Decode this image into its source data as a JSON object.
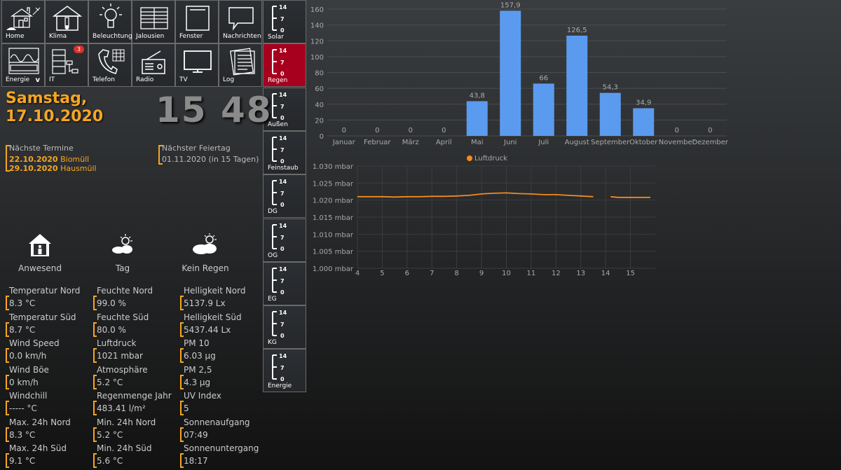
{
  "nav": [
    {
      "label": "Home",
      "icon": "house-icon"
    },
    {
      "label": "Klima",
      "icon": "thermometer-house-icon"
    },
    {
      "label": "Beleuchtung",
      "icon": "lightbulb-icon"
    },
    {
      "label": "Jalousien",
      "icon": "blinds-icon"
    },
    {
      "label": "Fenster",
      "icon": "window-icon"
    },
    {
      "label": "Nachrichten",
      "icon": "speech-bubble-icon"
    },
    {
      "label": "Energie",
      "icon": "energy-meter-icon"
    },
    {
      "label": "IT",
      "icon": "server-network-icon",
      "badge": "3"
    },
    {
      "label": "Telefon",
      "icon": "telephone-icon"
    },
    {
      "label": "Radio",
      "icon": "radio-icon"
    },
    {
      "label": "TV",
      "icon": "tv-icon"
    },
    {
      "label": "Log",
      "icon": "log-document-icon"
    }
  ],
  "side_tiles": [
    {
      "label": "Solar",
      "scale": [
        "14",
        "7",
        "0"
      ]
    },
    {
      "label": "Regen",
      "scale": [
        "14",
        "7",
        "0"
      ],
      "active": true
    },
    {
      "label": "Außen",
      "scale": [
        "14",
        "7",
        "0"
      ]
    },
    {
      "label": "Feinstaub",
      "scale": [
        "14",
        "7",
        "0"
      ]
    },
    {
      "label": "DG",
      "scale": [
        "14",
        "7",
        "0"
      ]
    },
    {
      "label": "OG",
      "scale": [
        "14",
        "7",
        "0"
      ]
    },
    {
      "label": "EG",
      "scale": [
        "14",
        "7",
        "0"
      ]
    },
    {
      "label": "KG",
      "scale": [
        "14",
        "7",
        "0"
      ]
    },
    {
      "label": "Energie",
      "scale": [
        "14",
        "7",
        "0"
      ]
    }
  ],
  "date": {
    "line1": "Samstag,",
    "line2": "17.10.2020"
  },
  "clock": {
    "hours": "15",
    "minutes": "48"
  },
  "termine": {
    "title": "Nächste Termine",
    "items": [
      {
        "date": "22.10.2020",
        "text": "Biomüll"
      },
      {
        "date": "29.10.2020",
        "text": "Hausmüll"
      }
    ]
  },
  "feiertag": {
    "title": "Nächster Feiertag",
    "value": "01.11.2020 (in 15 Tagen)"
  },
  "status": [
    {
      "label": "Anwesend",
      "icon": "house-person-icon"
    },
    {
      "label": "Tag",
      "icon": "sun-cloud-icon"
    },
    {
      "label": "Kein Regen",
      "icon": "cloud-sun-icon"
    }
  ],
  "sensors": [
    [
      {
        "name": "Temperatur Nord",
        "value": "8.3 °C"
      },
      {
        "name": "Temperatur Süd",
        "value": "8.7 °C"
      },
      {
        "name": "Wind Speed",
        "value": "0.0 km/h"
      },
      {
        "name": "Wind Böe",
        "value": "0 km/h"
      },
      {
        "name": "Windchill",
        "value": "----- °C"
      },
      {
        "name": "Max. 24h Nord",
        "value": "8.3 °C"
      },
      {
        "name": "Max. 24h Süd",
        "value": "9.1 °C"
      }
    ],
    [
      {
        "name": "Feuchte Nord",
        "value": "99.0 %"
      },
      {
        "name": "Feuchte Süd",
        "value": "80.0 %"
      },
      {
        "name": "Luftdruck",
        "value": "1021 mbar"
      },
      {
        "name": "Atmosphäre",
        "value": "5.2 °C"
      },
      {
        "name": "Regenmenge Jahr",
        "value": "483.41 l/m²"
      },
      {
        "name": "Min. 24h Nord",
        "value": "5.2 °C"
      },
      {
        "name": "Min. 24h Süd",
        "value": "5.6 °C"
      }
    ],
    [
      {
        "name": "Helligkeit Nord",
        "value": "5137.9 Lx"
      },
      {
        "name": "Helligkeit Süd",
        "value": "5437.44 Lx"
      },
      {
        "name": "PM 10",
        "value": "6.03 µg"
      },
      {
        "name": "PM 2,5",
        "value": "4.3 µg"
      },
      {
        "name": "UV Index",
        "value": "5"
      },
      {
        "name": "Sonnenaufgang",
        "value": "07:49"
      },
      {
        "name": "Sonnenuntergang",
        "value": "18:17"
      }
    ]
  ],
  "colors": {
    "accent": "#f5a623",
    "active_tile": "#a6001e",
    "bar": "#5b9bef",
    "line": "#f58a1f"
  },
  "chart_data": [
    {
      "type": "bar",
      "categories": [
        "Januar",
        "Februar",
        "März",
        "April",
        "Mai",
        "Juni",
        "Juli",
        "August",
        "September",
        "Oktober",
        "November",
        "Dezember"
      ],
      "values": [
        0,
        0,
        0,
        0,
        43.8,
        157.9,
        66,
        126.5,
        54.3,
        34.9,
        0,
        0
      ],
      "data_labels": [
        "0",
        "0",
        "0",
        "0",
        "43,8",
        "157,9",
        "66",
        "126,5",
        "54,3",
        "34,9",
        "0",
        "0"
      ],
      "yticks": [
        "0",
        "20",
        "40",
        "60",
        "80",
        "100",
        "120",
        "140",
        "160"
      ],
      "ylim": [
        0,
        160
      ],
      "grid": true
    },
    {
      "type": "line",
      "legend": "Luftdruck",
      "legend_position": "top",
      "x": [
        4,
        4.5,
        5,
        5.5,
        6,
        6.5,
        7,
        7.5,
        8,
        8.5,
        9,
        9.5,
        10,
        10.5,
        11,
        11.5,
        12,
        12.5,
        13,
        13.5,
        14,
        14.2,
        14.5,
        15,
        15.5,
        15.8
      ],
      "y": [
        1021,
        1021,
        1021,
        1020.9,
        1021,
        1021,
        1021.1,
        1021.1,
        1021.2,
        1021.4,
        1021.8,
        1022,
        1022.1,
        1021.9,
        1021.8,
        1021.6,
        1021.6,
        1021.4,
        1021.2,
        1021,
        null,
        1021,
        1020.8,
        1020.8,
        1020.8,
        1020.8
      ],
      "xticks": [
        "4",
        "5",
        "6",
        "7",
        "8",
        "9",
        "10",
        "11",
        "12",
        "13",
        "14",
        "15"
      ],
      "yticks": [
        "1.000 mbar",
        "1.005 mbar",
        "1.010 mbar",
        "1.015 mbar",
        "1.020 mbar",
        "1.025 mbar",
        "1.030 mbar"
      ],
      "ylim": [
        1000,
        1030
      ],
      "xlim": [
        4,
        16
      ],
      "grid": true
    }
  ]
}
